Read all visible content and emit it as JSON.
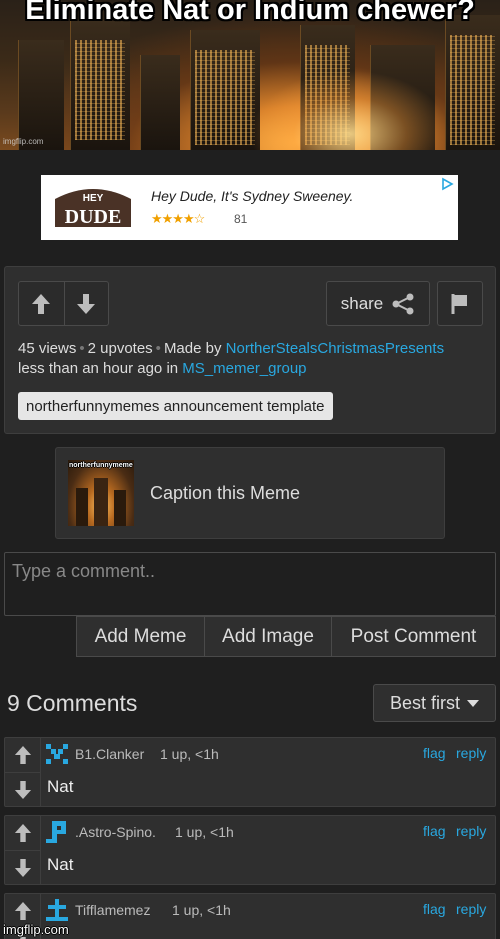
{
  "meme": {
    "caption": "Eliminate Nat or Indium chewer?",
    "watermark": "imgflip.com"
  },
  "ad": {
    "brand": "HEY DUDE",
    "headline": "Hey Dude, It's Sydney Sweeney.",
    "stars": "★★★★☆",
    "rating_count": "81"
  },
  "panel": {
    "share_label": "share",
    "views": "45 views",
    "upvotes": "2 upvotes",
    "made_by": "Made by",
    "author": "NortherStealsChristmasPresents",
    "time": "less than an hour ago in",
    "stream": "MS_memer_group",
    "template_tag": "northerfunnymemes announcement template"
  },
  "caption_box": {
    "thumb_text": "northerfunnymeme",
    "label": "Caption this Meme"
  },
  "comment_input": {
    "placeholder": "Type a comment.."
  },
  "comment_actions": [
    "Add Meme",
    "Add Image",
    "Post Comment"
  ],
  "comments_header": {
    "title": "9 Comments",
    "sort": "Best first"
  },
  "comments": [
    {
      "user": "B1.Clanker",
      "meta": "1 up, <1h",
      "text": "Nat",
      "flag": "flag",
      "reply": "reply",
      "avatar_color": "#29a8e0"
    },
    {
      "user": ".Astro-Spino.",
      "meta": "1 up, <1h",
      "text": "Nat",
      "flag": "flag",
      "reply": "reply",
      "avatar_color": "#29a8e0"
    },
    {
      "user": "Tifflamemez",
      "meta": "1 up, <1h",
      "text": "",
      "flag": "flag",
      "reply": "reply",
      "avatar_color": "#29a8e0"
    }
  ],
  "footer_watermark": "imgflip.com",
  "colors": {
    "background": "#1f1f1f",
    "panel": "#2f2f2f",
    "link": "#29a8e0",
    "icon": "#bdbdbd"
  }
}
